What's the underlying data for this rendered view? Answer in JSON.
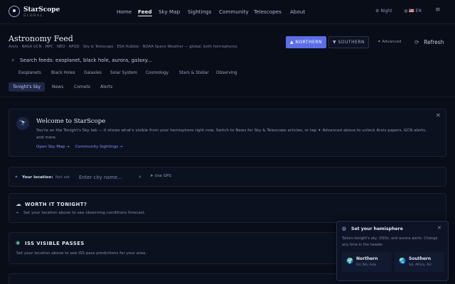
{
  "brand": {
    "name": "StarScope",
    "tagline": "GLOBAL"
  },
  "nav": [
    "Home",
    "Feed",
    "Sky Map",
    "Sightings",
    "Community",
    "Telescopes",
    "About"
  ],
  "header_right": {
    "theme": "Night",
    "language": "🇺🇸 EN",
    "theme_icon": "gear-icon",
    "lang_icon": "globe-icon"
  },
  "page": {
    "title": "Astronomy Feed",
    "subtitle": "Arxiv · NASA GCN · MPC · NEO · APOD · Sky & Telescope · ESA Hubble · NOAA Space Weather — global, both hemispheres"
  },
  "hemisphere": {
    "north_label": "▲ NORTHERN",
    "south_label": "▼ SOUTHERN",
    "selected": "northern"
  },
  "advanced_label": "✦ Advanced",
  "refresh_label": "Refresh",
  "search": {
    "placeholder": "Search feeds: exoplanet, black hole, aurora, galaxy..."
  },
  "categories": [
    "Exoplanets",
    "Black Holes",
    "Galaxies",
    "Solar System",
    "Cosmology",
    "Stars & Stellar",
    "Observing"
  ],
  "tabs": [
    "Tonight's Sky",
    "News",
    "Comets",
    "Alerts"
  ],
  "welcome": {
    "title": "Welcome to StarScope",
    "body": "You're on the Tonight's Sky tab — it shows what's visible from your hemisphere right now. Switch to News for Sky & Telescope articles, or tap ✦ Advanced above to unlock Arxiv papers, GCN alerts, and more.",
    "link_map": "Open Sky Map →",
    "link_sightings": "Community Sightings →"
  },
  "location": {
    "label": "Your location:",
    "status": "Not set",
    "placeholder": "Enter city name...",
    "gps_label": "Use GPS"
  },
  "worth_it": {
    "title": "WORTH IT TONIGHT?",
    "body": "Set your location above to see observing conditions forecast."
  },
  "iss": {
    "title": "ISS VISIBLE PASSES",
    "body": "Set your location above to see ISS pass predictions for your area."
  },
  "popup": {
    "title": "Set your hemisphere",
    "body": "Tailors tonight's sky, DSOs, and aurora alerts. Change any time in the header.",
    "north": {
      "name": "Northern",
      "regions": "EU, NA, Asia"
    },
    "south": {
      "name": "Southern",
      "regions": "SA, Africa, AU"
    }
  },
  "colors": {
    "accent": "#5b6ee8",
    "background": "#090d18",
    "card": "#0c1120"
  }
}
